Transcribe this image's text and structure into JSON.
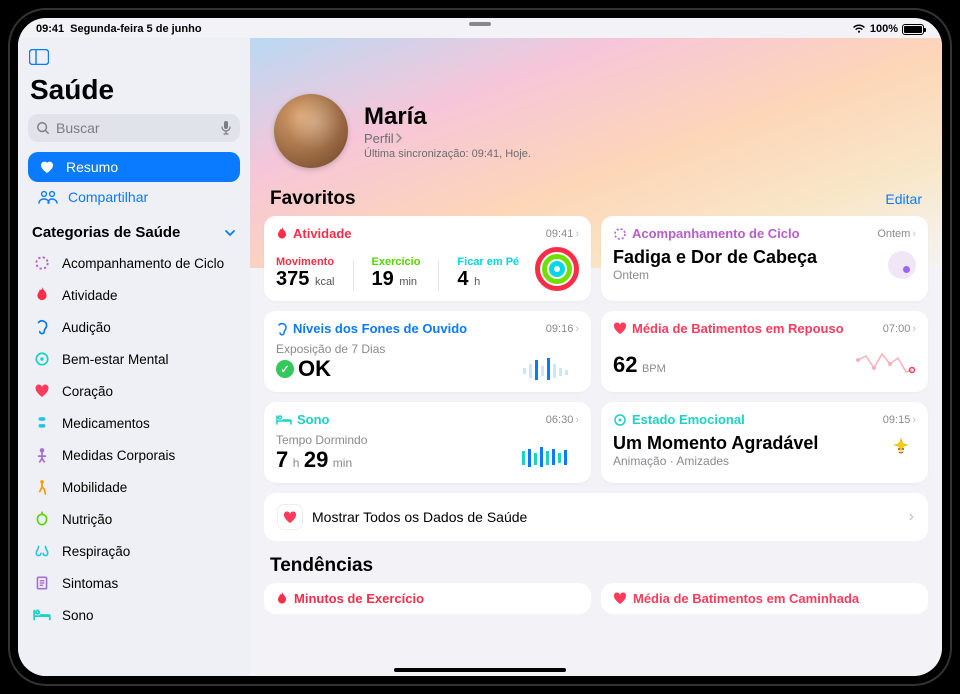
{
  "status": {
    "time": "09:41",
    "date": "Segunda-feira 5 de junho",
    "battery": "100%"
  },
  "app": {
    "title": "Saúde",
    "search_ph": "Buscar"
  },
  "nav": {
    "summary": "Resumo",
    "share": "Compartilhar",
    "cat_header": "Categorias de Saúde",
    "cats": [
      "Acompanhamento de Ciclo",
      "Atividade",
      "Audição",
      "Bem-estar Mental",
      "Coração",
      "Medicamentos",
      "Medidas Corporais",
      "Mobilidade",
      "Nutrição",
      "Respiração",
      "Sintomas",
      "Sono"
    ]
  },
  "profile": {
    "name": "María",
    "link": "Perfil",
    "sync": "Última sincronização: 09:41, Hoje."
  },
  "fav": {
    "title": "Favoritos",
    "edit": "Editar"
  },
  "activity": {
    "cat": "Atividade",
    "time": "09:41",
    "move_lbl": "Movimento",
    "move_val": "375",
    "move_unit": "kcal",
    "ex_lbl": "Exercício",
    "ex_val": "19",
    "ex_unit": "min",
    "stand_lbl": "Ficar em Pé",
    "stand_val": "4",
    "stand_unit": "h"
  },
  "cycle": {
    "cat": "Acompanhamento de Ciclo",
    "time": "Ontem",
    "headline": "Fadiga e Dor de Cabeça",
    "sub": "Ontem"
  },
  "hearing": {
    "cat": "Níveis dos Fones de Ouvido",
    "time": "09:16",
    "sub": "Exposição de 7 Dias",
    "val": "OK"
  },
  "heart": {
    "cat": "Média de Batimentos em Repouso",
    "time": "07:00",
    "val": "62",
    "unit": "BPM"
  },
  "sleep": {
    "cat": "Sono",
    "time": "06:30",
    "sub": "Tempo Dormindo",
    "h": "7",
    "h_u": "h",
    "m": "29",
    "m_u": "min"
  },
  "mood": {
    "cat": "Estado Emocional",
    "time": "09:15",
    "headline": "Um Momento Agradável",
    "sub": "Animação · Amizades"
  },
  "showall": "Mostrar Todos os Dados de Saúde",
  "trends": {
    "title": "Tendências",
    "ex": "Minutos de Exercício",
    "walk": "Média de Batimentos em Caminhada"
  },
  "colors": {
    "move": "#fa2d48",
    "ex": "#6fe000",
    "stand": "#00d8e8",
    "cycle": "#b75dce",
    "heart": "#ff3b5c",
    "sleep": "#19d3c5",
    "hearing": "#0a7aff",
    "mood": "#19d3c5"
  }
}
